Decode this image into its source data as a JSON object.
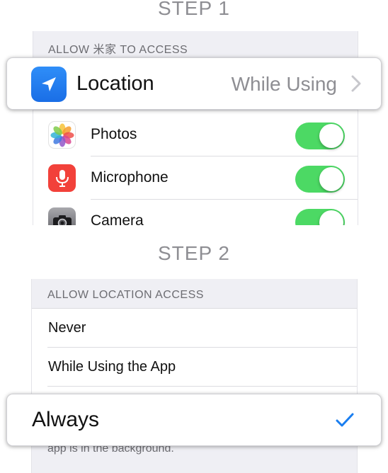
{
  "step1": {
    "title": "STEP 1",
    "section_header": "ALLOW 米家 TO ACCESS",
    "location": {
      "label": "Location",
      "value": "While Using"
    },
    "permissions": [
      {
        "label": "Photos",
        "enabled": true,
        "icon": "photos-icon"
      },
      {
        "label": "Microphone",
        "enabled": true,
        "icon": "microphone-icon"
      },
      {
        "label": "Camera",
        "enabled": true,
        "icon": "camera-icon"
      }
    ]
  },
  "step2": {
    "title": "STEP 2",
    "section_header": "ALLOW LOCATION ACCESS",
    "options": [
      {
        "label": "Never"
      },
      {
        "label": "While Using the App"
      },
      {
        "label": "Always",
        "selected": true
      }
    ],
    "footer_text": "app is in the background."
  },
  "colors": {
    "toggle_on": "#4cd964",
    "accent_blue": "#1a7ef0",
    "mic_red": "#f2413a",
    "secondary_text": "#8e8e93",
    "grouped_bg": "#efeff4"
  }
}
